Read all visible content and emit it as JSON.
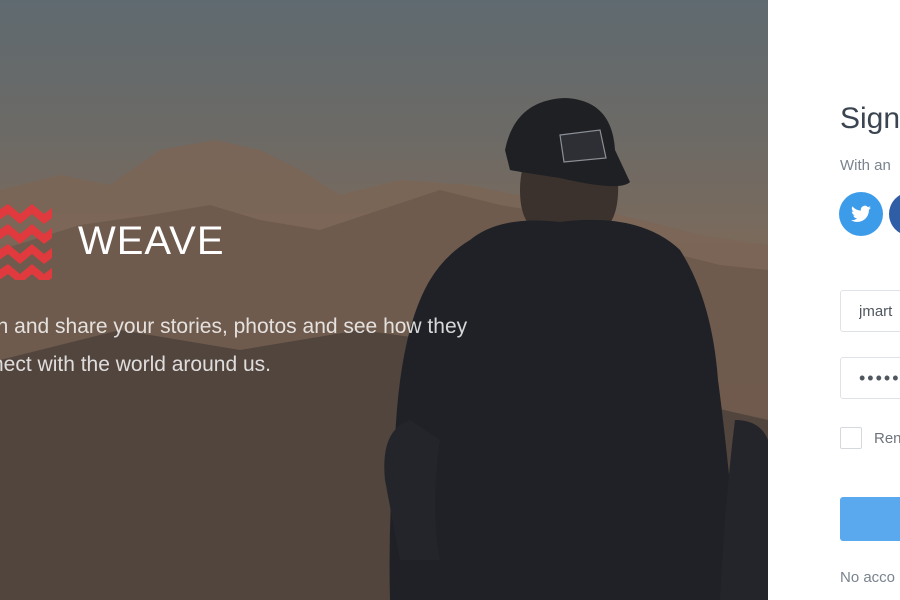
{
  "brand": {
    "name": "WEAVE",
    "tagline_line1": "in and share your stories, photos and see how they",
    "tagline_line2": "nect with the world around us.",
    "logo_color": "#e03a3e"
  },
  "login": {
    "title": "Sign",
    "subtitle": "With an",
    "social": [
      {
        "name": "twitter-icon",
        "color": "#3d9cea"
      },
      {
        "name": "facebook-icon",
        "color": "#2f5da6"
      }
    ],
    "email_value": "jmart",
    "password_value": "•••••",
    "remember_label": "Ren",
    "submit_label": "",
    "no_account_text": "No acco"
  },
  "colors": {
    "accent": "#5aa8ee",
    "text_dark": "#3b4451",
    "text_muted": "#7a838e"
  }
}
